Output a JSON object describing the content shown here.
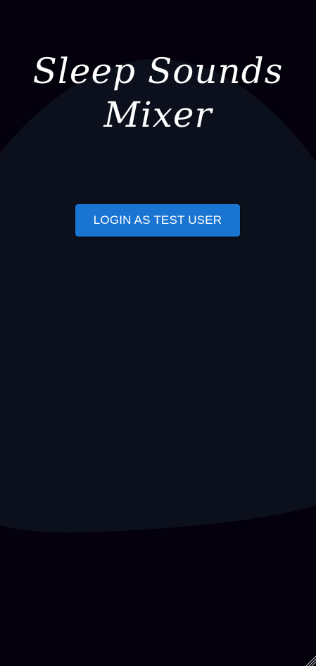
{
  "app": {
    "title_line1": "Sleep Sounds",
    "title_line2": "Mixer"
  },
  "login": {
    "button_label": "LOGIN AS TEST USER"
  },
  "colors": {
    "background": "#05010c",
    "blob": "#0b101c",
    "accent": "#1a74d2",
    "text": "#ffffff"
  }
}
